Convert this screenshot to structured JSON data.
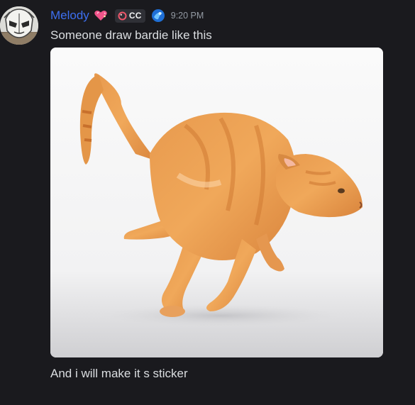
{
  "message": {
    "author": "Melody",
    "clan_tag": "CC",
    "timestamp": "9:20 PM",
    "lines": [
      "Someone draw bardie like this",
      "And i will make it s sticker"
    ],
    "attachment": {
      "kind": "image",
      "subject": "orange tabby cat running"
    }
  },
  "icons": {
    "avatar": "masked-character-avatar",
    "heart_badge": "sparkle-heart-icon",
    "clan_tag_icon": "bubble-ring-icon",
    "role_icon": "blue-orb-icon"
  },
  "colors": {
    "background": "#1a1a1e",
    "username": "#3d6ff0",
    "text": "#dbdee1",
    "timestamp": "#949ba4",
    "tag_background": "#2f3036"
  }
}
